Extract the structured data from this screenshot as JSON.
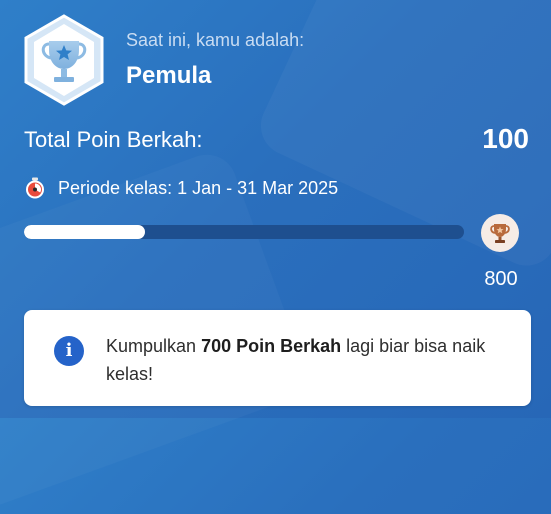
{
  "status": {
    "subtitle": "Saat ini, kamu adalah:",
    "level": "Pemula",
    "badge_icon": "trophy-star-icon"
  },
  "points": {
    "label": "Total Poin Berkah:",
    "value": "100"
  },
  "period": {
    "icon": "stopwatch-icon",
    "text": "Periode kelas: 1 Jan - 31 Mar 2025"
  },
  "progress": {
    "current": 100,
    "target": 800,
    "target_label": "800",
    "fraction": 0.275,
    "target_icon": "bronze-trophy-icon"
  },
  "info": {
    "icon": "info-icon",
    "prefix": "Kumpulkan ",
    "bold": "700 Poin Berkah",
    "suffix": " lagi biar bisa naik kelas!"
  },
  "colors": {
    "background": "#2a6fbd",
    "progress_track": "#1e4f8f",
    "progress_fill": "#ffffff",
    "info_icon": "#2563c9"
  }
}
